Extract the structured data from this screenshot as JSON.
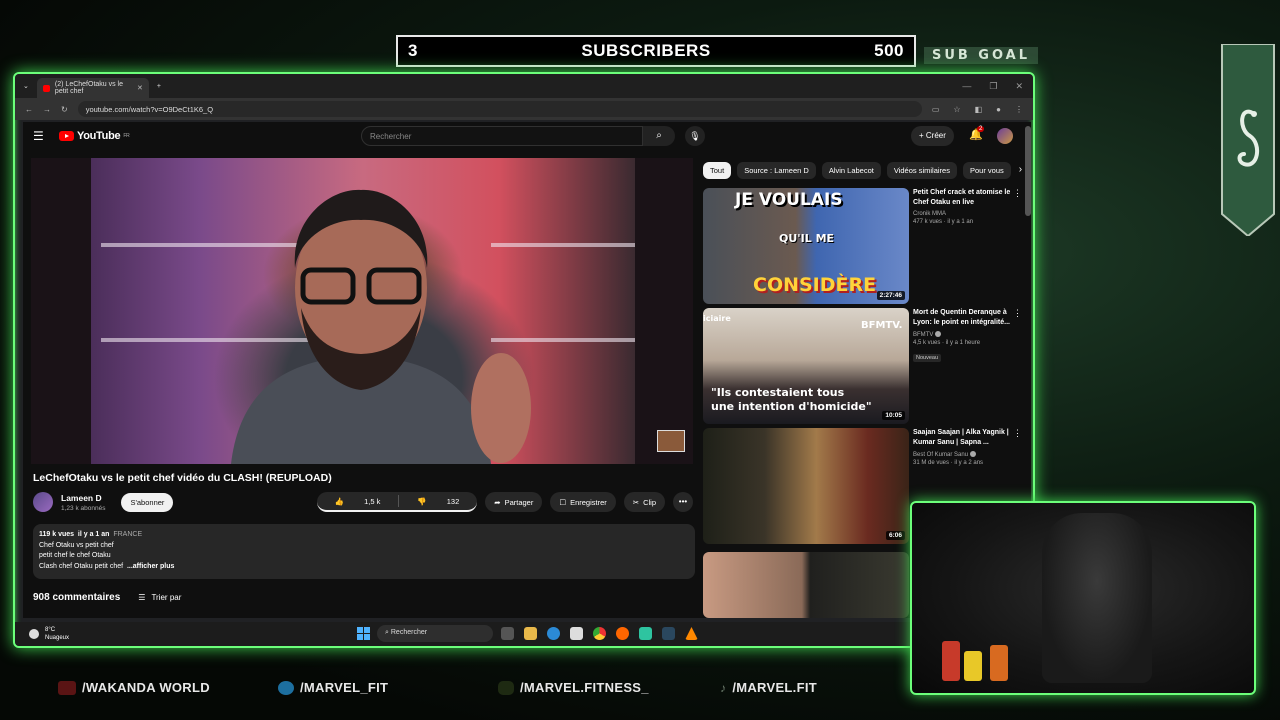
{
  "overlay": {
    "sub_current": "3",
    "sub_label": "SUBSCRIBERS",
    "sub_target": "500",
    "sub_goal_label": "SUB GOAL",
    "socials": [
      {
        "handle": "/WAKANDA WORLD",
        "icon": "youtube-icon"
      },
      {
        "handle": "/MARVEL_FIT",
        "icon": "twitter-icon"
      },
      {
        "handle": "/MARVEL.FITNESS_",
        "icon": "instagram-icon"
      },
      {
        "handle": "/MARVEL.FIT",
        "icon": "tiktok-icon"
      }
    ],
    "accent_color": "#6cff7a"
  },
  "browser": {
    "tab_title": "(2) LeChefOtaku vs le petit chef",
    "url": "youtube.com/watch?v=O9DeCt1K6_Q"
  },
  "youtube": {
    "search_placeholder": "Rechercher",
    "create_label": "Créer",
    "notif_count": "2",
    "video": {
      "title": "LeChefOtaku vs le petit chef vidéo du CLASH! (REUPLOAD)",
      "channel": "Lameen D",
      "subscribers": "1,23 k abonnés",
      "subscribe_label": "S'abonner",
      "likes": "1,5 k",
      "dislikes": "132",
      "share_label": "Partager",
      "save_label": "Enregistrer",
      "clip_label": "Clip"
    },
    "description": {
      "views": "119 k vues",
      "date": "il y a 1 an",
      "location": "FRANCE",
      "lines": [
        "Chef Otaku vs petit chef",
        "petit chef le chef Otaku",
        "Clash chef Otaku petit chef"
      ],
      "more_label": "...afficher plus"
    },
    "comments": {
      "count_label": "908 commentaires",
      "sort_label": "Trier par"
    },
    "chips": [
      "Tout",
      "Source : Lameen D",
      "Alvin Labecot",
      "Vidéos similaires",
      "Pour vous"
    ],
    "recommendations": [
      {
        "title": "Petit Chef crack et atomise le Chef Otaku en live",
        "channel": "Cronik MMA",
        "stats": "477 k vues · il y a 1 an",
        "duration": "2:27:46",
        "thumb_texts": [
          "JE VOULAIS",
          "QU'IL ME",
          "CONSIDÈRE"
        ]
      },
      {
        "title": "Mort de Quentin Deranque à Lyon: le point en intégralité...",
        "channel": "BFMTV",
        "stats": "4,5 k vues · il y a 1 heure",
        "badge": "Nouveau",
        "duration": "10:05",
        "thumb_texts": [
          "iciaire",
          "BFMTV.",
          "\"Ils contestaient tous",
          "une intention d'homicide\""
        ]
      },
      {
        "title": "Saajan Saajan | Alka Yagnik | Kumar Sanu | Sapna ...",
        "channel": "Best Of Kumar Sanu",
        "stats": "31 M de vues · il y a 2 ans",
        "duration": "6:06",
        "thumb_texts": []
      }
    ]
  },
  "taskbar": {
    "temp": "8°C",
    "weather": "Nuageux",
    "search_label": "Rechercher"
  }
}
